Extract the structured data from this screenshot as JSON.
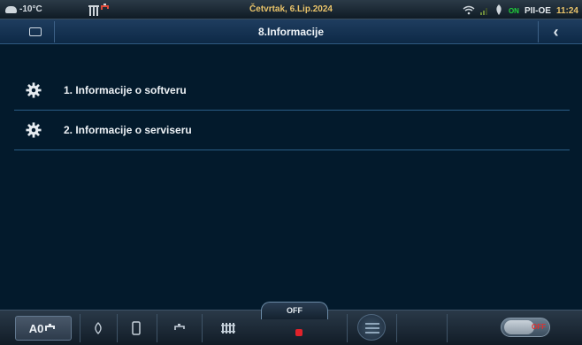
{
  "status_bar": {
    "outdoor_temp": "-10°C",
    "date": "Četvrtak, 6.Lip.2024",
    "status_on": "ON",
    "mode": "PII-OE",
    "time": "11:24"
  },
  "header": {
    "title": "8.Informacije"
  },
  "menu": {
    "items": [
      {
        "label": "1.  Informacije o softveru"
      },
      {
        "label": "2.  Informacije o serviseru"
      }
    ]
  },
  "bottom_bar": {
    "active_label": "A0",
    "off_tab_label": "OFF",
    "toggle_label": "OFF"
  },
  "colors": {
    "accent_date": "#e9c36a",
    "background": "#031a2c",
    "status_red": "#e0222a"
  }
}
